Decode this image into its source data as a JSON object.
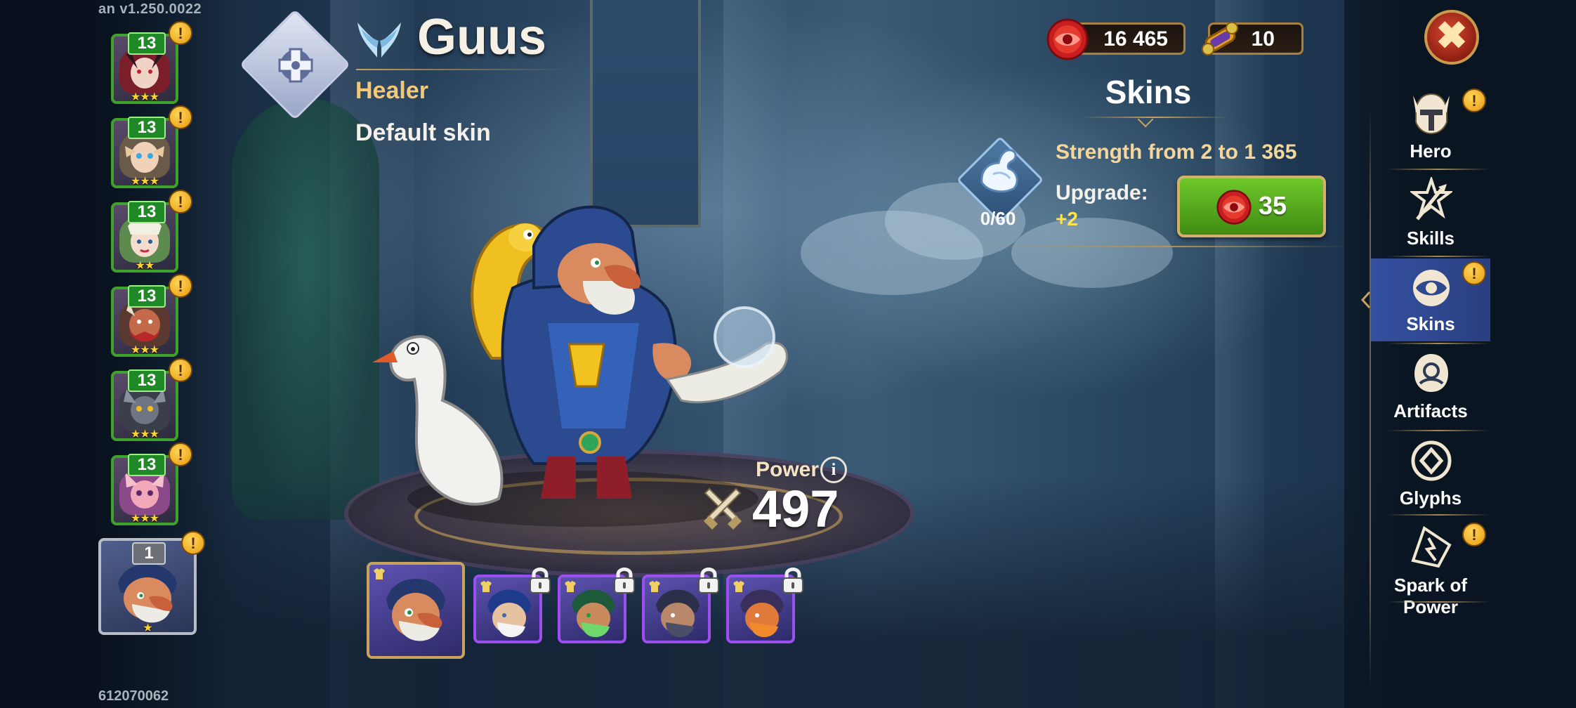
{
  "build_version": "an v1.250.0022",
  "player_id": "612070062",
  "hero": {
    "name": "Guus",
    "class": "Healer",
    "skin_name": "Default skin",
    "power_label": "Power",
    "power_value": "497",
    "class_icon": "healer-cross-icon",
    "faction_icon": "wings-icon"
  },
  "currencies": {
    "skin_stones": "16 465",
    "scrolls": "10"
  },
  "skins_panel": {
    "title": "Skins",
    "stat_description": "Strength from 2 to 1 365",
    "stat_progress": "0/60",
    "upgrade_label": "Upgrade:",
    "upgrade_value": "+2",
    "upgrade_cost": "35"
  },
  "hero_list": [
    {
      "level": "13",
      "stars": "★★★",
      "alert": "!"
    },
    {
      "level": "13",
      "stars": "★★★",
      "alert": "!"
    },
    {
      "level": "13",
      "stars": "★★",
      "alert": "!"
    },
    {
      "level": "13",
      "stars": "★★★",
      "alert": "!"
    },
    {
      "level": "13",
      "stars": "★★★",
      "alert": "!"
    },
    {
      "level": "13",
      "stars": "★★★",
      "alert": "!"
    },
    {
      "level": "1",
      "stars": "★",
      "alert": "!",
      "selected": true
    }
  ],
  "skins": [
    {
      "name": "Default skin",
      "selected": true,
      "locked": false
    },
    {
      "locked": true
    },
    {
      "locked": true
    },
    {
      "locked": true
    },
    {
      "locked": true
    }
  ],
  "nav": {
    "hero": "Hero",
    "skills": "Skills",
    "skins": "Skins",
    "artifacts": "Artifacts",
    "glyphs": "Glyphs",
    "spark": "Spark of Power",
    "active": "Skins"
  },
  "alert_symbol": "!",
  "close_symbol": "✖",
  "colors": {
    "accent_gold": "#f5c877",
    "upgrade_green": "#4f9f1a",
    "level_badge_green": "#1f8a25",
    "nav_active": "#3451a0",
    "skin_frame_purple": "#9c4ef0"
  }
}
